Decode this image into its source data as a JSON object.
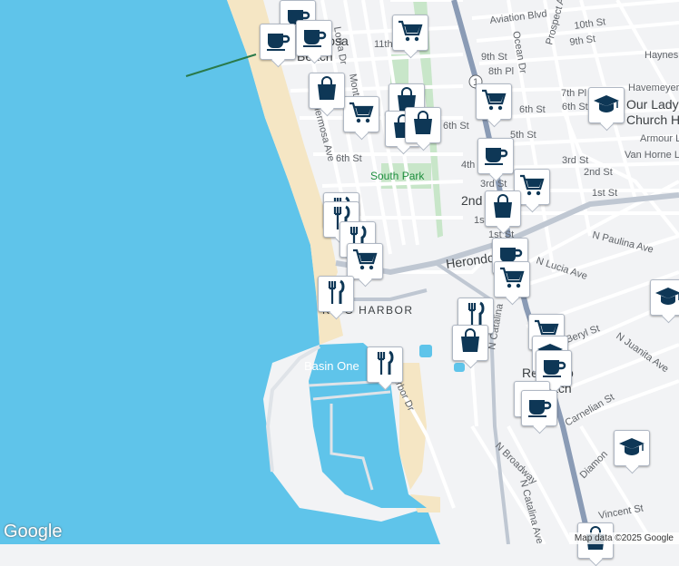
{
  "map": {
    "labels": {
      "aviation": "Aviation Blvd",
      "tenth_st": "10th St",
      "ninth_st_a": "9th St",
      "ninth_st_b": "9th St",
      "eighth_pl": "8th Pl",
      "haynes": "Haynes",
      "havemeyer": "Havemeyer",
      "seventh_pl": "7th Pl",
      "sixth_st_a": "6th St",
      "sixth_st_b": "6th St",
      "sixth_st_c": "6th St",
      "fifth_st": "5th St",
      "fourth_st": "4th St",
      "third_st_a": "3rd St",
      "third_st_b": "3rd St",
      "second_st_a": "2nd St",
      "second_st_b": "2nd St",
      "first_st_a": "1st St",
      "first_st_b": "1st St",
      "armour": "Armour L",
      "van_horne": "Van Horne L",
      "our_lady_1": "Our Lady o",
      "our_lady_2": "Church He",
      "loma": "Loma Dr",
      "monte": "Monte",
      "eleventh": "11th",
      "ocean_dr": "Ocean Dr",
      "prospect": "Prospect Av",
      "hermosa_beach_1": "Hermosa",
      "hermosa_beach_2": "Beach",
      "hermosa_ave": "Hermosa Ave",
      "south_park": "South Park",
      "herondo": "Herondo",
      "n_lucia": "N Lucia Ave",
      "n_paulina": "N Paulina Ave",
      "king_harbor": "KING HARBOR",
      "basin_one": "Basin One",
      "harbor_dr": "Harbor Dr",
      "n_catalina": "N Catalina",
      "n_catalina_ave": "N Catalina Ave",
      "redondo_1": "Redondo",
      "redondo_2": "Beach",
      "beryl": "Beryl St",
      "n_juanita": "N Juanita Ave",
      "carnelian": "Carnelian St",
      "n_broadway": "N Broadway",
      "diamond": "Diamon",
      "vincent": "Vincent St",
      "route_1": "1"
    },
    "pins": [
      {
        "icon": "coffee-icon"
      },
      {
        "icon": "coffee-icon"
      },
      {
        "icon": "coffee-icon"
      },
      {
        "icon": "cart-icon"
      },
      {
        "icon": "bag-icon"
      },
      {
        "icon": "cart-icon"
      },
      {
        "icon": "bag-icon"
      },
      {
        "icon": "bag-icon"
      },
      {
        "icon": "bag-icon"
      },
      {
        "icon": "cart-icon"
      },
      {
        "icon": "school-icon"
      },
      {
        "icon": "coffee-icon"
      },
      {
        "icon": "cart-icon"
      },
      {
        "icon": "restaurant-icon"
      },
      {
        "icon": "bag-icon"
      },
      {
        "icon": "restaurant-icon"
      },
      {
        "icon": "restaurant-icon"
      },
      {
        "icon": "cart-icon"
      },
      {
        "icon": "restaurant-icon"
      },
      {
        "icon": "coffee-icon"
      },
      {
        "icon": "cart-icon"
      },
      {
        "icon": "school-icon"
      },
      {
        "icon": "restaurant-icon"
      },
      {
        "icon": "bag-icon"
      },
      {
        "icon": "restaurant-icon"
      },
      {
        "icon": "cart-icon"
      },
      {
        "icon": "school-icon"
      },
      {
        "icon": "coffee-icon"
      },
      {
        "icon": "coffee-icon"
      },
      {
        "icon": "coffee-icon"
      },
      {
        "icon": "school-icon"
      },
      {
        "icon": "bag-icon"
      }
    ]
  },
  "footer": {
    "logo": "Google",
    "attribution": "Map data ©2025 Google"
  },
  "colors": {
    "ocean": "#5fc4ea",
    "sand": "#f5e6c4",
    "land": "#f2f3f5",
    "park": "#c8e6c9",
    "highway": "#8a9bb5",
    "icon": "#0e3756"
  }
}
